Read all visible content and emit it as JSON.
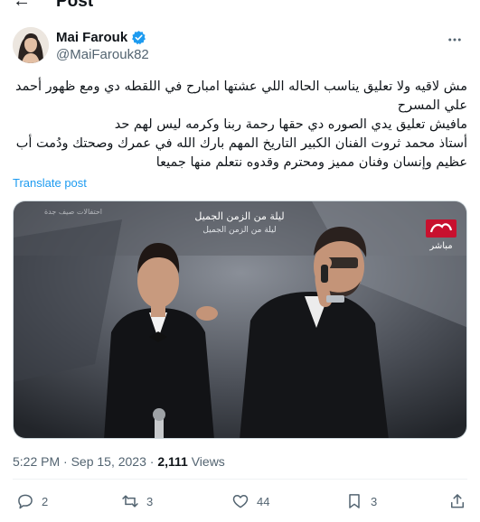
{
  "header": {
    "title": "Post"
  },
  "author": {
    "name": "Mai Farouk",
    "handle": "@MaiFarouk82",
    "verified": true
  },
  "tweet": {
    "lines": [
      "مش لاقيه ولا تعليق يناسب الحاله اللي عشتها امبارح في اللقطه دي ومع ظهور أحمد علي المسرح",
      "مافيش تعليق يدي الصوره دي حقها  رحمة ربنا وكرمه ليس لهم حد",
      "أستاذ محمد ثروت الفنان الكبير التاريخ المهم بارك الله في عمرك وصحتك ودُمت أب عظيم وإنسان وفنان مميز ومحترم وقدوه نتعلم منها جميعا"
    ],
    "translate_label": "Translate post",
    "media": {
      "banner_text_1": "ليلة من الزمن الجميل",
      "banner_text_2": "ليلة من الزمن الجميل",
      "side_text": "احتفالات صيف جدة",
      "channel_logo_label": "مباشر"
    },
    "timestamp": "5:22 PM · Sep 15, 2023",
    "separator": " · ",
    "views_count": "2,111",
    "views_label": " Views"
  },
  "actions": {
    "replies": "2",
    "reposts": "3",
    "likes": "44",
    "bookmarks": "3"
  },
  "colors": {
    "accent": "#1d9bf0",
    "text": "#0f1419",
    "secondary": "#536471",
    "logo_red": "#c8102e"
  }
}
